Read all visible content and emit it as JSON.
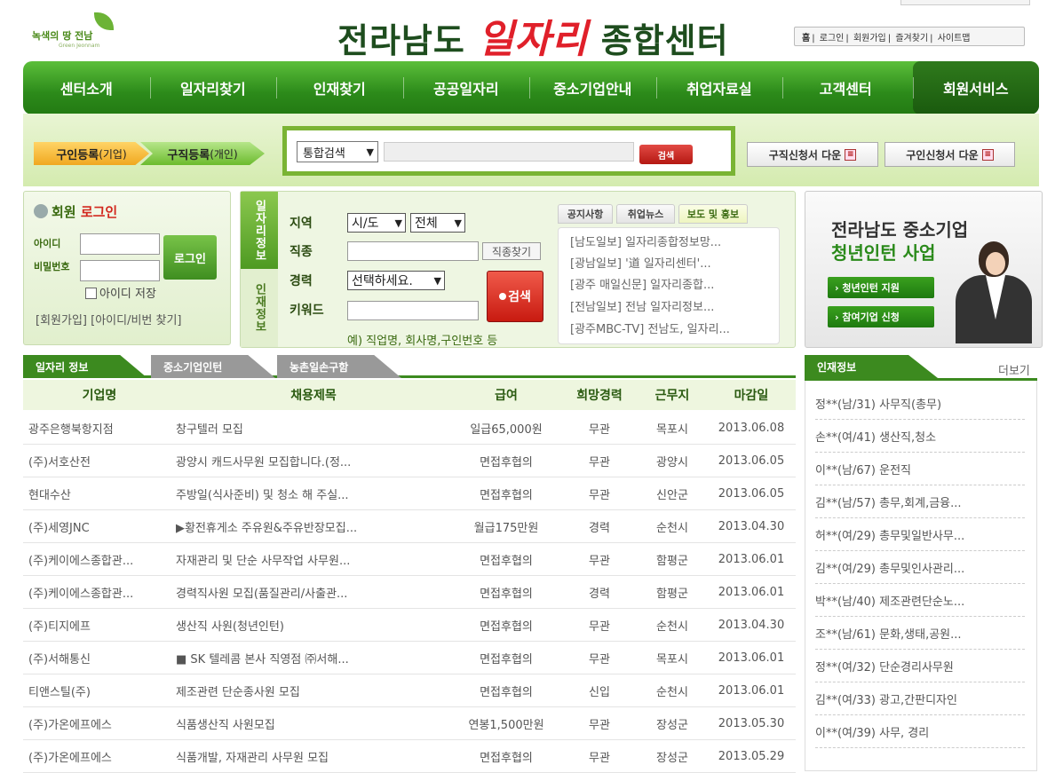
{
  "header": {
    "logo_text": "녹색의 땅 전남",
    "logo_sub": "Green Jeonnam",
    "title_pre": "전라남도 ",
    "title_red": "일자리",
    "title_post": " 종합센터",
    "toplinks": [
      "홈",
      "로그인",
      "회원가입",
      "즐겨찾기",
      "사이트맵"
    ]
  },
  "nav": {
    "items": [
      "센터소개",
      "일자리찾기",
      "인재찾기",
      "공공일자리",
      "중소기업안내",
      "취업자료실",
      "고객센터",
      "회원서비스"
    ]
  },
  "search_bar": {
    "reg_company_main": "구인등록",
    "reg_company_sub": "(기업)",
    "reg_person_main": "구직등록",
    "reg_person_sub": "(개인)",
    "select_value": "통합검색",
    "search_button": "검색",
    "download_seek": "구직신청서 다운",
    "download_offer": "구인신청서 다운"
  },
  "login": {
    "title_prefix": "회원 ",
    "title_red": "로그인",
    "id_label": "아이디",
    "pw_label": "비밀번호",
    "login_button": "로그인",
    "save_id": "아이디 저장",
    "links": "[회원가입] [아이디/비번 찾기]"
  },
  "job_search": {
    "tab_job": "일자리정보",
    "tab_talent": "인재정보",
    "region_label": "지역",
    "region_select1": "시/도",
    "region_select2": "전체",
    "type_label": "직종",
    "type_button": "직종찾기",
    "career_label": "경력",
    "career_select": "선택하세요.",
    "keyword_label": "키워드",
    "search_button": "검색",
    "example": "예) 직업명, 회사명,구인번호 등"
  },
  "news": {
    "tabs": [
      "공지사항",
      "취업뉴스",
      "보도 및 홍보"
    ],
    "items": [
      "[남도일보] 일자리종합정보망...",
      "[광남일보] '道 일자리센터'...",
      "[광주 매일신문] 일자리종합...",
      "[전남일보] 전남 일자리정보...",
      "[광주MBC-TV] 전남도, 일자리..."
    ]
  },
  "banner": {
    "title1": "전라남도 중소기업",
    "title2": "청년인턴 사업",
    "btn1": "› 청년인턴 지원",
    "btn2": "› 참여기업 신청"
  },
  "jobs": {
    "tabs": [
      "일자리 정보",
      "중소기업인턴",
      "농촌일손구함"
    ],
    "headers": [
      "기업명",
      "채용제목",
      "급여",
      "희망경력",
      "근무지",
      "마감일"
    ],
    "rows": [
      [
        "광주은행북항지점",
        "창구텔러 모집",
        "일급65,000원",
        "무관",
        "목포시",
        "2013.06.08"
      ],
      [
        "(주)서호산전",
        "광양시 캐드사무원 모집합니다.(정...",
        "면접후협의",
        "무관",
        "광양시",
        "2013.06.05"
      ],
      [
        "현대수산",
        "주방일(식사준비) 및 청소 해 주실...",
        "면접후협의",
        "무관",
        "신안군",
        "2013.06.05"
      ],
      [
        "(주)세영JNC",
        "▶황전휴게소 주유원&주유반장모집...",
        "월급175만원",
        "경력",
        "순천시",
        "2013.04.30"
      ],
      [
        "(주)케이에스종합관...",
        "자재관리 및 단순 사무작업 사무원...",
        "면접후협의",
        "무관",
        "함평군",
        "2013.06.01"
      ],
      [
        "(주)케이에스종합관...",
        "경력직사원 모집(품질관리/사출관...",
        "면접후협의",
        "경력",
        "함평군",
        "2013.06.01"
      ],
      [
        "(주)티지에프",
        "생산직 사원(청년인턴)",
        "면접후협의",
        "무관",
        "순천시",
        "2013.04.30"
      ],
      [
        "(주)서해통신",
        "■ SK 텔레콤 본사 직영점 ㈜서해...",
        "면접후협의",
        "무관",
        "목포시",
        "2013.06.01"
      ],
      [
        "티앤스틸(주)",
        "제조관련 단순종사원 모집",
        "면접후협의",
        "신입",
        "순천시",
        "2013.06.01"
      ],
      [
        "(주)가온에프에스",
        "식품생산직 사원모집",
        "연봉1,500만원",
        "무관",
        "장성군",
        "2013.05.30"
      ],
      [
        "(주)가온에프에스",
        "식품개발, 자재관리 사무원 모집",
        "면접후협의",
        "무관",
        "장성군",
        "2013.05.29"
      ]
    ]
  },
  "people": {
    "tab": "인재정보",
    "more": "더보기",
    "items": [
      "정**(남/31) 사무직(총무)",
      "손**(여/41) 생산직,청소",
      "이**(남/67) 운전직",
      "김**(남/57) 총무,회계,금융...",
      "허**(여/29) 총무및일반사무...",
      "김**(여/29) 총무및인사관리...",
      "박**(남/40) 제조관련단순노...",
      "조**(남/61) 문화,생태,공원...",
      "정**(여/32) 단순경리사무원",
      "김**(여/33) 광고,간판디자인",
      "이**(여/39) 사무, 경리"
    ]
  }
}
